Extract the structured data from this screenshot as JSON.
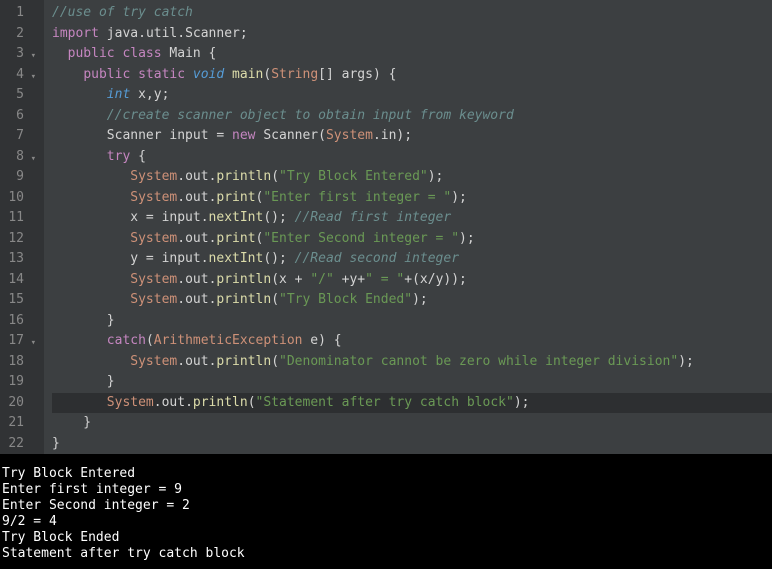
{
  "editor": {
    "lines": [
      {
        "num": "1",
        "fold": false,
        "tokens": [
          [
            "comment",
            "//use of try catch"
          ]
        ]
      },
      {
        "num": "2",
        "fold": false,
        "tokens": [
          [
            "keyword",
            "import"
          ],
          [
            "punct",
            " java"
          ],
          [
            "punct",
            "."
          ],
          [
            "class",
            "util"
          ],
          [
            "punct",
            "."
          ],
          [
            "class",
            "Scanner"
          ],
          [
            "punct",
            ";"
          ]
        ]
      },
      {
        "num": "3",
        "fold": true,
        "tokens": [
          [
            "punct",
            "  "
          ],
          [
            "keyword",
            "public"
          ],
          [
            "punct",
            " "
          ],
          [
            "keyword",
            "class"
          ],
          [
            "punct",
            " "
          ],
          [
            "class",
            "Main"
          ],
          [
            "punct",
            " {"
          ]
        ]
      },
      {
        "num": "4",
        "fold": true,
        "tokens": [
          [
            "punct",
            "    "
          ],
          [
            "keyword",
            "public"
          ],
          [
            "punct",
            " "
          ],
          [
            "keyword",
            "static"
          ],
          [
            "punct",
            " "
          ],
          [
            "type",
            "void"
          ],
          [
            "punct",
            " "
          ],
          [
            "method",
            "main"
          ],
          [
            "punct",
            "("
          ],
          [
            "special",
            "String"
          ],
          [
            "punct",
            "[] args) {"
          ]
        ]
      },
      {
        "num": "5",
        "fold": false,
        "tokens": [
          [
            "punct",
            "       "
          ],
          [
            "type",
            "int"
          ],
          [
            "punct",
            " x,y;"
          ]
        ]
      },
      {
        "num": "6",
        "fold": false,
        "tokens": [
          [
            "punct",
            "       "
          ],
          [
            "comment",
            "//create scanner object to obtain input from keyword"
          ]
        ]
      },
      {
        "num": "7",
        "fold": false,
        "tokens": [
          [
            "punct",
            "       Scanner input "
          ],
          [
            "punct",
            "= "
          ],
          [
            "keyword",
            "new"
          ],
          [
            "punct",
            " Scanner("
          ],
          [
            "special",
            "System"
          ],
          [
            "punct",
            "."
          ],
          [
            "var",
            "in"
          ],
          [
            "punct",
            ");"
          ]
        ]
      },
      {
        "num": "8",
        "fold": true,
        "tokens": [
          [
            "punct",
            "       "
          ],
          [
            "keyword",
            "try"
          ],
          [
            "punct",
            " {"
          ]
        ]
      },
      {
        "num": "9",
        "fold": false,
        "tokens": [
          [
            "punct",
            "          "
          ],
          [
            "special",
            "System"
          ],
          [
            "punct",
            "."
          ],
          [
            "var",
            "out"
          ],
          [
            "punct",
            "."
          ],
          [
            "method",
            "println"
          ],
          [
            "punct",
            "("
          ],
          [
            "string",
            "\"Try Block Entered\""
          ],
          [
            "punct",
            ");"
          ]
        ]
      },
      {
        "num": "10",
        "fold": false,
        "tokens": [
          [
            "punct",
            "          "
          ],
          [
            "special",
            "System"
          ],
          [
            "punct",
            "."
          ],
          [
            "var",
            "out"
          ],
          [
            "punct",
            "."
          ],
          [
            "method",
            "print"
          ],
          [
            "punct",
            "("
          ],
          [
            "string",
            "\"Enter first integer = \""
          ],
          [
            "punct",
            ");"
          ]
        ]
      },
      {
        "num": "11",
        "fold": false,
        "tokens": [
          [
            "punct",
            "          x "
          ],
          [
            "punct",
            "= input."
          ],
          [
            "method",
            "nextInt"
          ],
          [
            "punct",
            "(); "
          ],
          [
            "comment",
            "//Read first integer"
          ]
        ]
      },
      {
        "num": "12",
        "fold": false,
        "tokens": [
          [
            "punct",
            "          "
          ],
          [
            "special",
            "System"
          ],
          [
            "punct",
            "."
          ],
          [
            "var",
            "out"
          ],
          [
            "punct",
            "."
          ],
          [
            "method",
            "print"
          ],
          [
            "punct",
            "("
          ],
          [
            "string",
            "\"Enter Second integer = \""
          ],
          [
            "punct",
            ");"
          ]
        ]
      },
      {
        "num": "13",
        "fold": false,
        "tokens": [
          [
            "punct",
            "          y "
          ],
          [
            "punct",
            "= input."
          ],
          [
            "method",
            "nextInt"
          ],
          [
            "punct",
            "(); "
          ],
          [
            "comment",
            "//Read second integer"
          ]
        ]
      },
      {
        "num": "14",
        "fold": false,
        "tokens": [
          [
            "punct",
            "          "
          ],
          [
            "special",
            "System"
          ],
          [
            "punct",
            "."
          ],
          [
            "var",
            "out"
          ],
          [
            "punct",
            "."
          ],
          [
            "method",
            "println"
          ],
          [
            "punct",
            "(x + "
          ],
          [
            "string",
            "\"/\""
          ],
          [
            "punct",
            " +y+"
          ],
          [
            "string",
            "\" = \""
          ],
          [
            "punct",
            "+(x/y));"
          ]
        ]
      },
      {
        "num": "15",
        "fold": false,
        "tokens": [
          [
            "punct",
            "          "
          ],
          [
            "special",
            "System"
          ],
          [
            "punct",
            "."
          ],
          [
            "var",
            "out"
          ],
          [
            "punct",
            "."
          ],
          [
            "method",
            "println"
          ],
          [
            "punct",
            "("
          ],
          [
            "string",
            "\"Try Block Ended\""
          ],
          [
            "punct",
            ");"
          ]
        ]
      },
      {
        "num": "16",
        "fold": false,
        "tokens": [
          [
            "punct",
            "       }"
          ]
        ]
      },
      {
        "num": "17",
        "fold": true,
        "tokens": [
          [
            "punct",
            "       "
          ],
          [
            "keyword",
            "catch"
          ],
          [
            "punct",
            "("
          ],
          [
            "special",
            "ArithmeticException"
          ],
          [
            "punct",
            " e) {"
          ]
        ]
      },
      {
        "num": "18",
        "fold": false,
        "tokens": [
          [
            "punct",
            "          "
          ],
          [
            "special",
            "System"
          ],
          [
            "punct",
            "."
          ],
          [
            "var",
            "out"
          ],
          [
            "punct",
            "."
          ],
          [
            "method",
            "println"
          ],
          [
            "punct",
            "("
          ],
          [
            "string",
            "\"Denominator cannot be zero while integer division\""
          ],
          [
            "punct",
            ");"
          ]
        ]
      },
      {
        "num": "19",
        "fold": false,
        "tokens": [
          [
            "punct",
            "       }"
          ]
        ]
      },
      {
        "num": "20",
        "fold": false,
        "hl": true,
        "tokens": [
          [
            "punct",
            "       "
          ],
          [
            "special",
            "System"
          ],
          [
            "punct",
            "."
          ],
          [
            "var",
            "out"
          ],
          [
            "punct",
            "."
          ],
          [
            "method",
            "println"
          ],
          [
            "punct",
            "("
          ],
          [
            "string",
            "\"Statement after try catch block\""
          ],
          [
            "punct",
            ");"
          ]
        ]
      },
      {
        "num": "21",
        "fold": false,
        "tokens": [
          [
            "punct",
            "    }"
          ]
        ]
      },
      {
        "num": "22",
        "fold": false,
        "tokens": [
          [
            "punct",
            "}"
          ]
        ]
      }
    ]
  },
  "console": {
    "lines": [
      "Try Block Entered",
      "Enter first integer = 9",
      "Enter Second integer = 2",
      "9/2 = 4",
      "Try Block Ended",
      "Statement after try catch block"
    ]
  }
}
